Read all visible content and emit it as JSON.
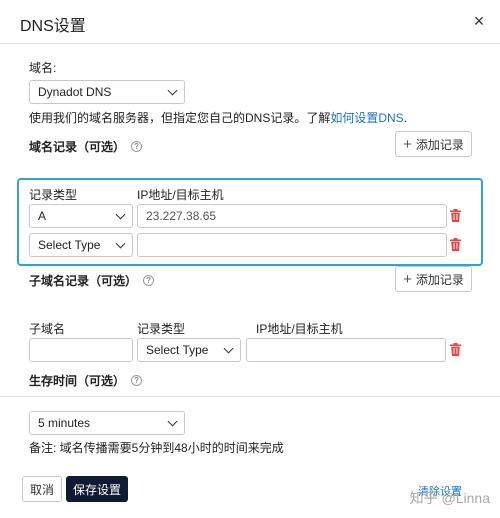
{
  "dialog": {
    "title": "DNS设置",
    "close_glyph": "×"
  },
  "domain": {
    "label": "域名:",
    "selected": "Dynadot DNS",
    "note_prefix": "使用我们的域名服务器，但指定您自己的DNS记录。了解",
    "note_link": "如何设置DNS",
    "note_suffix": "."
  },
  "domain_records": {
    "heading": "域名记录（可选）",
    "add_label": "添加记录",
    "col_type": "记录类型",
    "col_target": "IP地址/目标主机",
    "rows": [
      {
        "type": "A",
        "target": "23.227.38.65"
      },
      {
        "type": "Select Type",
        "target": ""
      }
    ]
  },
  "subdomain_records": {
    "heading": "子域名记录（可选）",
    "add_label": "添加记录",
    "col_sub": "子域名",
    "col_type": "记录类型",
    "col_target": "IP地址/目标主机",
    "rows": [
      {
        "sub": "",
        "type": "Select Type",
        "target": ""
      }
    ]
  },
  "ttl": {
    "heading": "生存时间（可选）",
    "selected": "5 minutes",
    "note": "备注: 域名传播需要5分钟到48小时的时间来完成"
  },
  "footer": {
    "cancel": "取消",
    "save": "保存设置",
    "clear": "清除设置"
  },
  "watermark": "知乎 @Linna",
  "colors": {
    "accent": "#2aa6d6",
    "primary_button": "#111a33",
    "link": "#1a73c8",
    "delete": "#e04848"
  }
}
